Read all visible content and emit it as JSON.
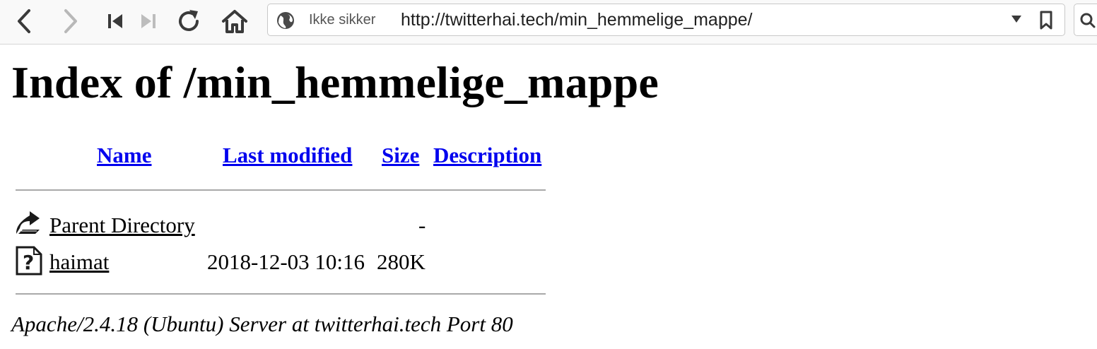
{
  "browser": {
    "security_label": "Ikke sikker",
    "url": "http://twitterhai.tech/min_hemmelige_mappe/",
    "icons": [
      "back-icon",
      "forward-icon",
      "first-icon",
      "last-icon",
      "reload-icon",
      "home-icon",
      "globe-icon",
      "chevron-down-icon",
      "bookmark-icon",
      "search-icon"
    ]
  },
  "page": {
    "title": "Index of /min_hemmelige_mappe",
    "columns": {
      "name": "Name",
      "last_modified": "Last modified",
      "size": "Size",
      "description": "Description"
    },
    "rows": [
      {
        "name": "Parent Directory",
        "last_modified": "",
        "size": "-",
        "description": "",
        "icon": "parent-directory-icon"
      },
      {
        "name": "haimat",
        "last_modified": "2018-12-03 10:16",
        "size": "280K",
        "description": "",
        "icon": "unknown-file-icon"
      }
    ],
    "footer": "Apache/2.4.18 (Ubuntu) Server at twitterhai.tech Port 80"
  }
}
